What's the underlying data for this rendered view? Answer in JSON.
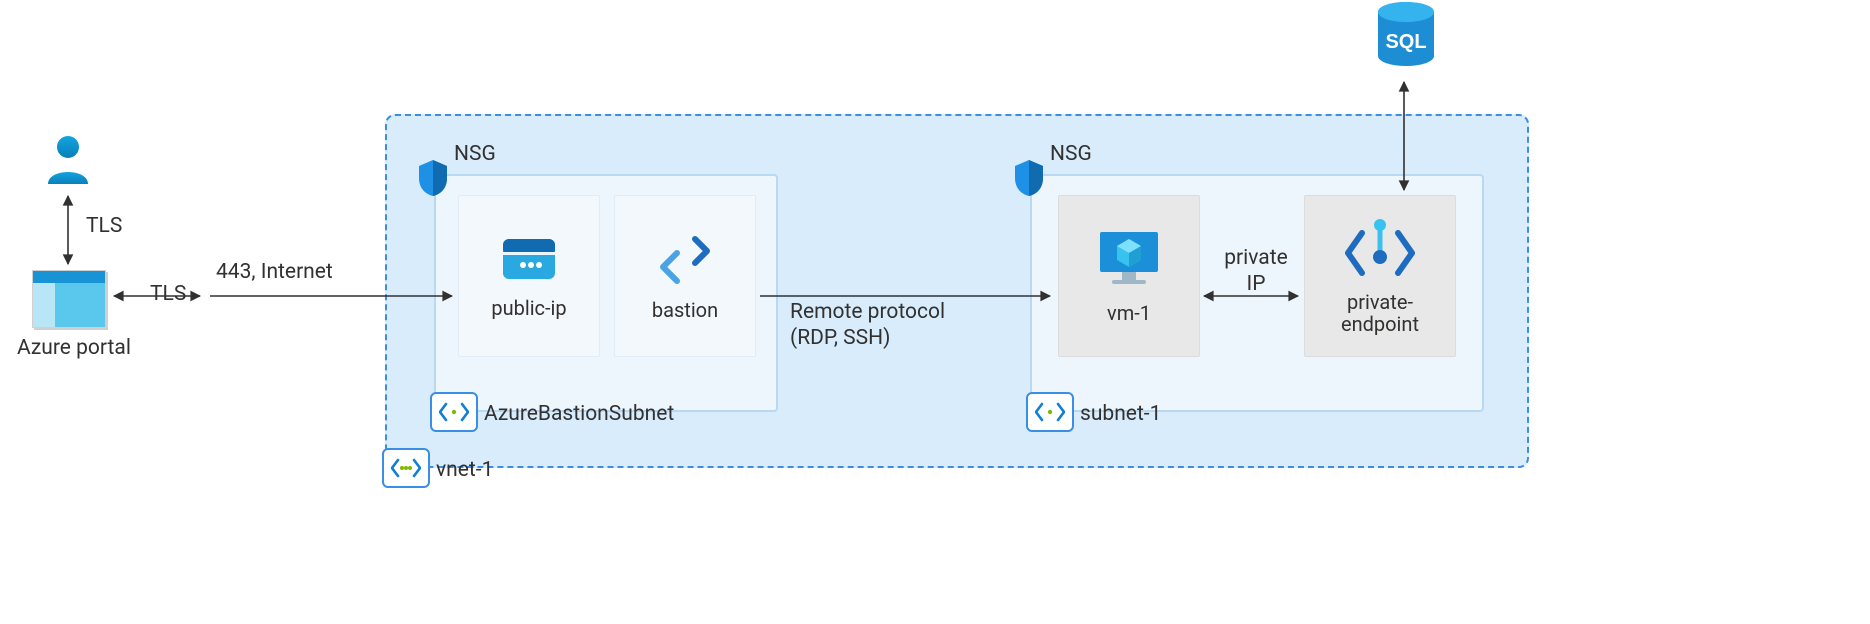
{
  "user_label": "",
  "portal_label": "Azure portal",
  "tls_vert": "TLS",
  "tls_horiz": "TLS",
  "internet_443": "443, Internet",
  "nsg_left": "NSG",
  "nsg_right": "NSG",
  "vnet_label": "vnet-1",
  "subnets": {
    "bastion_label": "AzureBastionSubnet",
    "subnet1_label": "subnet-1"
  },
  "nodes": {
    "publicip": "public-ip",
    "bastion": "bastion",
    "vm": "vm-1",
    "pe_line1": "private-",
    "pe_line2": "endpoint"
  },
  "remote_line1": "Remote protocol",
  "remote_line2": "(RDP, SSH)",
  "private_ip_line1": "private",
  "private_ip_line2": "IP",
  "sql_label": "SQL",
  "icons": {
    "user": "user-icon",
    "portal": "portal-icon",
    "shield": "shield-icon",
    "vnet_badge": "vnet-icon",
    "subnet_badge": "subnet-icon",
    "publicip": "publicip-icon",
    "bastion": "bastion-icon",
    "vm": "vm-icon",
    "pe": "private-endpoint-icon",
    "sql": "sql-icon"
  },
  "colors": {
    "azure_blue": "#0f80d7",
    "cyan": "#32c8e8",
    "dark": "#323130",
    "vnet_bg": "#d9ecfb",
    "subnet_bg": "#edf5fd"
  }
}
